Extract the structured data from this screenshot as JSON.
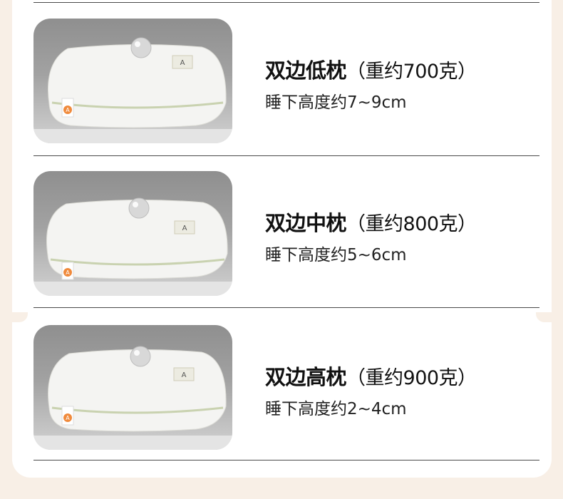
{
  "items": [
    {
      "name": "双边低枕",
      "weight": "（重约700克）",
      "height_label": "睡下高度约7~9cm",
      "tag_icon": "orange-a-tag-icon"
    },
    {
      "name": "双边中枕",
      "weight": "（重约800克）",
      "height_label": "睡下高度约5~6cm",
      "tag_icon": "orange-a-tag-icon"
    },
    {
      "name": "双边高枕",
      "weight": "（重约900克）",
      "height_label": "睡下高度约2~4cm",
      "tag_icon": "orange-a-tag-icon"
    }
  ],
  "colors": {
    "background": "#f8efe6",
    "card": "#ffffff",
    "text": "#111111",
    "tag_accent": "#f08a3c"
  }
}
